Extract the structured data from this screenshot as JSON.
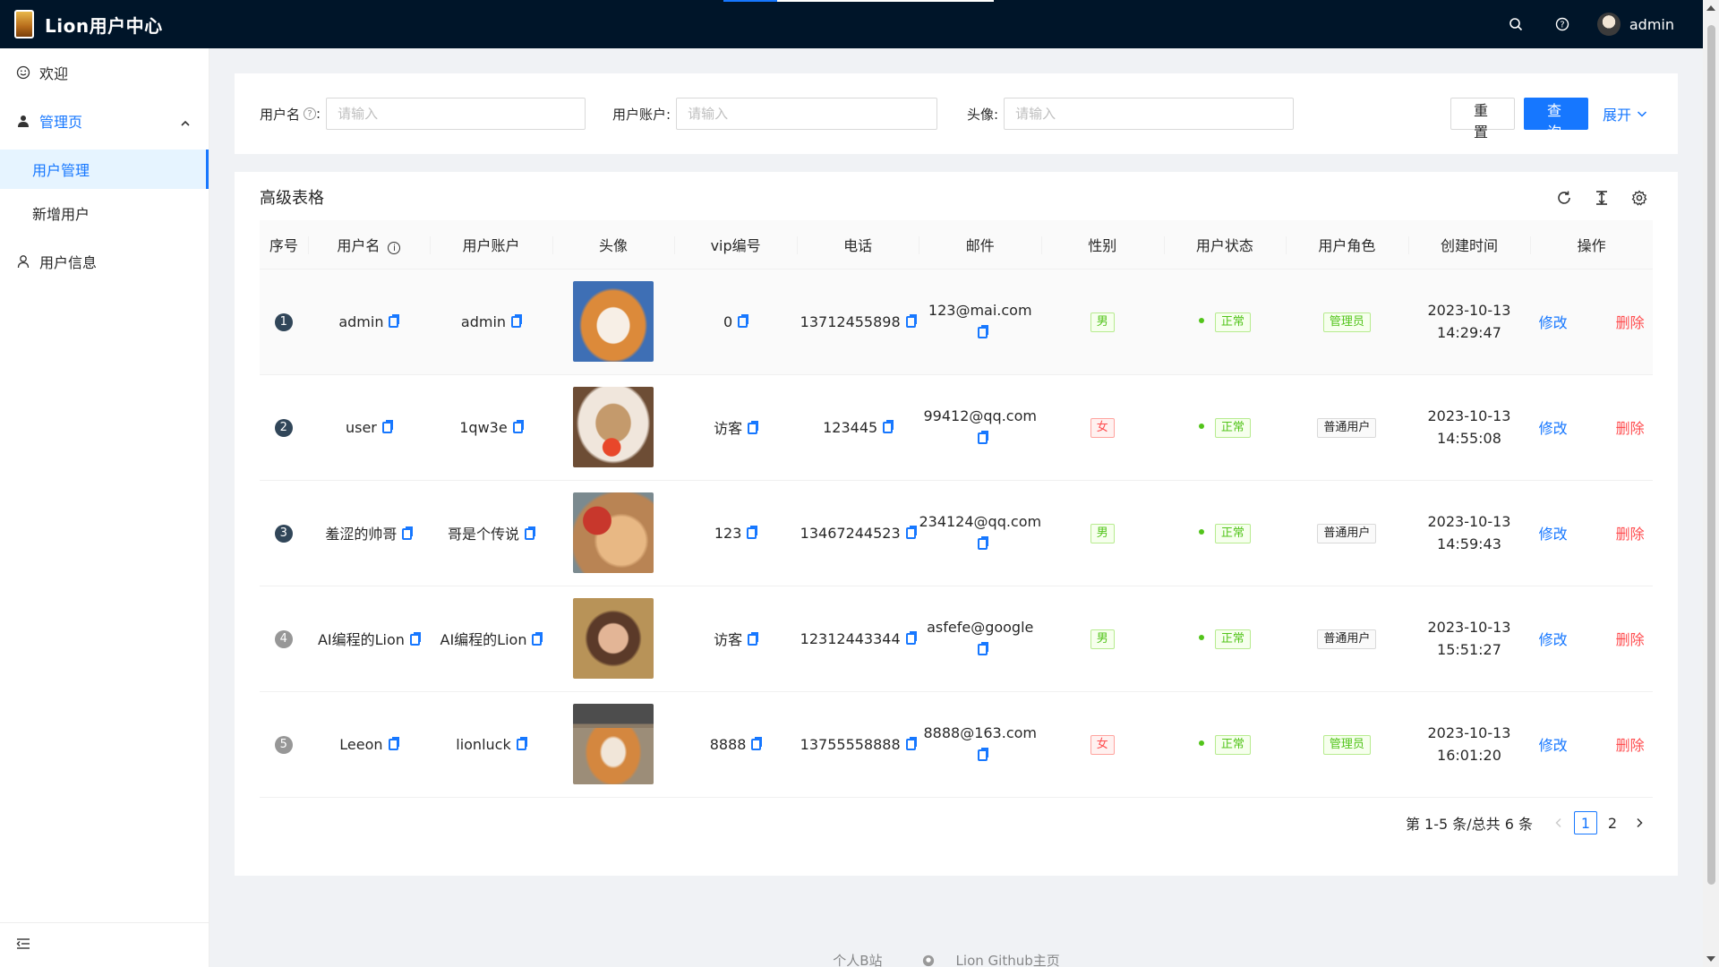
{
  "header": {
    "title": "Lion用户中心",
    "user_name": "admin",
    "icons": [
      "search-icon",
      "question-icon"
    ]
  },
  "sidebar": {
    "items": [
      {
        "label": "欢迎",
        "icon": "smile-icon"
      },
      {
        "label": "管理页",
        "icon": "crown-icon"
      },
      {
        "label": "用户信息",
        "icon": "user-icon"
      }
    ],
    "sub_items": [
      {
        "label": "用户管理",
        "active": true
      },
      {
        "label": "新增用户",
        "active": false
      }
    ]
  },
  "search": {
    "username_label": "用户名",
    "account_label": "用户账户:",
    "avatar_label": "头像:",
    "colon": ":",
    "placeholder": "请输入",
    "reset_label": "重置",
    "query_label": "查询",
    "expand_label": "展开"
  },
  "table": {
    "title": "高级表格",
    "columns": [
      "序号",
      "用户名",
      "用户账户",
      "头像",
      "vip编号",
      "电话",
      "邮件",
      "性别",
      "用户状态",
      "用户角色",
      "创建时间",
      "操作"
    ],
    "edit_label": "修改",
    "delete_label": "删除",
    "rows": [
      {
        "idx": "1",
        "username": "admin",
        "account": "admin",
        "vip": "0",
        "phone": "13712455898",
        "email": "123@mai.com",
        "gender": "男",
        "status": "正常",
        "role": "管理员",
        "date": "2023-10-13",
        "time": "14:29:47"
      },
      {
        "idx": "2",
        "username": "user",
        "account": "1qw3e",
        "vip": "访客",
        "phone": "123445",
        "email": "99412@qq.com",
        "gender": "女",
        "status": "正常",
        "role": "普通用户",
        "date": "2023-10-13",
        "time": "14:55:08"
      },
      {
        "idx": "3",
        "username": "羞涩的帅哥",
        "account": "哥是个传说",
        "vip": "123",
        "phone": "13467244523",
        "email": "234124@qq.com",
        "gender": "男",
        "status": "正常",
        "role": "普通用户",
        "date": "2023-10-13",
        "time": "14:59:43"
      },
      {
        "idx": "4",
        "username": "AI编程的Lion",
        "account": "AI编程的Lion",
        "vip": "访客",
        "phone": "12312443344",
        "email": "asfefe@google",
        "gender": "男",
        "status": "正常",
        "role": "普通用户",
        "date": "2023-10-13",
        "time": "15:51:27"
      },
      {
        "idx": "5",
        "username": "Leeon",
        "account": "lionluck",
        "vip": "8888",
        "phone": "13755558888",
        "email": "8888@163.com",
        "gender": "女",
        "status": "正常",
        "role": "管理员",
        "date": "2023-10-13",
        "time": "16:01:20"
      }
    ]
  },
  "pagination": {
    "total_text": "第 1-5 条/总共 6 条",
    "pages": [
      "1",
      "2"
    ],
    "current": "1"
  },
  "footer": {
    "links": [
      "个人B站",
      "Lion Github主页"
    ]
  },
  "colors": {
    "header_bg": "#001529",
    "primary": "#1677ff",
    "success": "#52c41a",
    "danger": "#ff4d4f"
  }
}
